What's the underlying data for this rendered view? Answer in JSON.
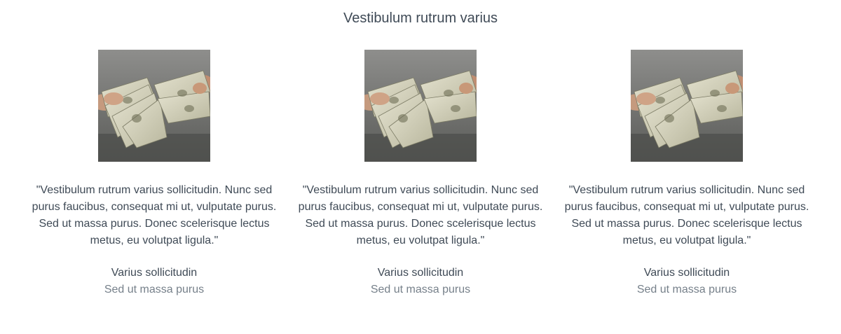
{
  "section": {
    "title": "Vestibulum rutrum varius"
  },
  "testimonials": [
    {
      "image_icon": "money-in-hands-photo",
      "quote": "\"Vestibulum rutrum varius sollicitudin. Nunc sed purus faucibus, consequat mi ut, vulputate purus. Sed ut massa purus. Donec scelerisque lectus metus, eu volutpat ligula.\"",
      "name": "Varius sollicitudin",
      "role": "Sed ut massa purus"
    },
    {
      "image_icon": "money-in-hands-photo",
      "quote": "\"Vestibulum rutrum varius sollicitudin. Nunc sed purus faucibus, consequat mi ut, vulputate purus. Sed ut massa purus. Donec scelerisque lectus metus, eu volutpat ligula.\"",
      "name": "Varius sollicitudin",
      "role": "Sed ut massa purus"
    },
    {
      "image_icon": "money-in-hands-photo",
      "quote": "\"Vestibulum rutrum varius sollicitudin. Nunc sed purus faucibus, consequat mi ut, vulputate purus. Sed ut massa purus. Donec scelerisque lectus metus, eu volutpat ligula.\"",
      "name": "Varius sollicitudin",
      "role": "Sed ut massa purus"
    }
  ],
  "colors": {
    "text": "#3f4a56",
    "muted": "#76808a",
    "background": "#ffffff"
  }
}
